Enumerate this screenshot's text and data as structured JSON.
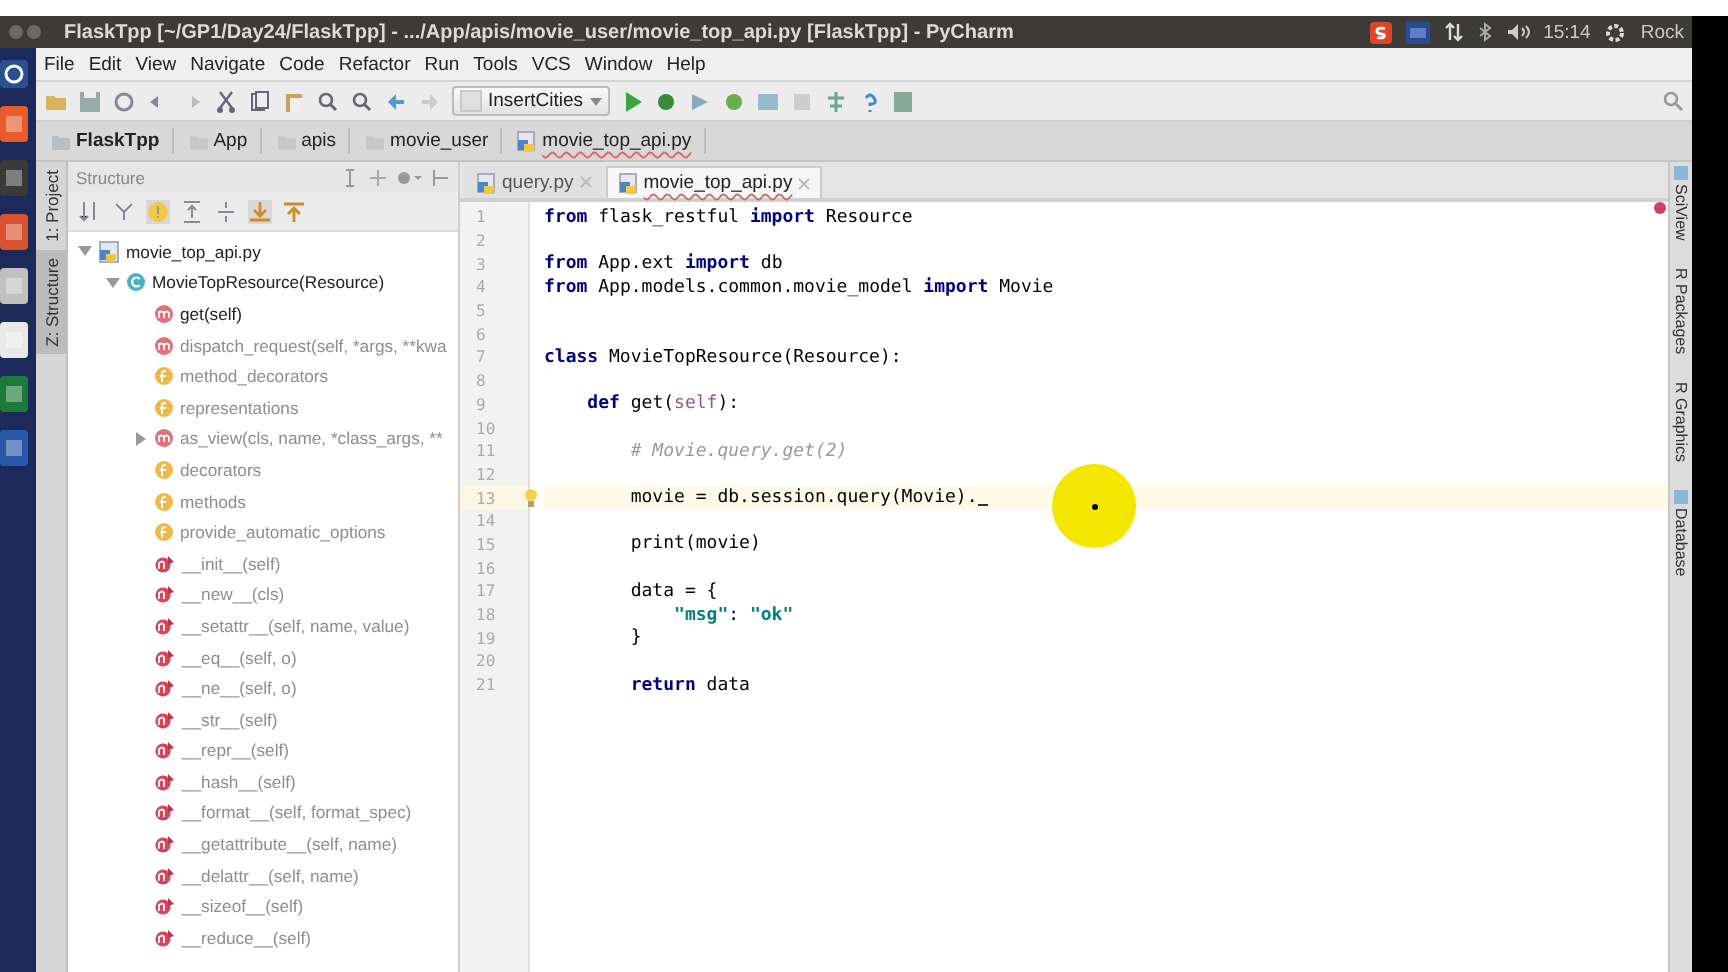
{
  "desktop": {
    "clock": "15:14",
    "user": "Rock"
  },
  "window": {
    "title": "FlaskTpp [~/GP1/Day24/FlaskTpp] - .../App/apis/movie_user/movie_top_api.py [FlaskTpp] - PyCharm"
  },
  "menu": [
    "File",
    "Edit",
    "View",
    "Navigate",
    "Code",
    "Refactor",
    "Run",
    "Tools",
    "VCS",
    "Window",
    "Help"
  ],
  "toolbar": {
    "run_config": "InsertCities"
  },
  "breadcrumbs": [
    {
      "label": "FlaskTpp",
      "kind": "project"
    },
    {
      "label": "App",
      "kind": "folder"
    },
    {
      "label": "apis",
      "kind": "folder"
    },
    {
      "label": "movie_user",
      "kind": "folder"
    },
    {
      "label": "movie_top_api.py",
      "kind": "file"
    }
  ],
  "left_tool_tabs": [
    {
      "label": "1: Project",
      "selected": false
    },
    {
      "label": "Z: Structure",
      "selected": true
    }
  ],
  "structure": {
    "title": "Structure",
    "tree": [
      {
        "label": "movie_top_api.py",
        "kind": "file",
        "expanded": true,
        "children": [
          {
            "label": "MovieTopResource(Resource)",
            "kind": "class",
            "expanded": true,
            "children": [
              {
                "label": "get(self)",
                "kind": "method",
                "inherited": false
              },
              {
                "label": "dispatch_request(self, *args, **kwa",
                "kind": "method",
                "inherited": true
              },
              {
                "label": "method_decorators",
                "kind": "field",
                "inherited": true
              },
              {
                "label": "representations",
                "kind": "field",
                "inherited": true
              },
              {
                "label": "as_view(cls, name, *class_args, **",
                "kind": "method",
                "inherited": true,
                "expanded": false
              },
              {
                "label": "decorators",
                "kind": "field",
                "inherited": true
              },
              {
                "label": "methods",
                "kind": "field",
                "inherited": true
              },
              {
                "label": "provide_automatic_options",
                "kind": "field",
                "inherited": true
              },
              {
                "label": "__init__(self)",
                "kind": "special",
                "inherited": true
              },
              {
                "label": "__new__(cls)",
                "kind": "special",
                "inherited": true
              },
              {
                "label": "__setattr__(self, name, value)",
                "kind": "special",
                "inherited": true
              },
              {
                "label": "__eq__(self, o)",
                "kind": "special",
                "inherited": true
              },
              {
                "label": "__ne__(self, o)",
                "kind": "special",
                "inherited": true
              },
              {
                "label": "__str__(self)",
                "kind": "special",
                "inherited": true
              },
              {
                "label": "__repr__(self)",
                "kind": "special",
                "inherited": true
              },
              {
                "label": "__hash__(self)",
                "kind": "special",
                "inherited": true
              },
              {
                "label": "__format__(self, format_spec)",
                "kind": "special",
                "inherited": true
              },
              {
                "label": "__getattribute__(self, name)",
                "kind": "special",
                "inherited": true
              },
              {
                "label": "__delattr__(self, name)",
                "kind": "special",
                "inherited": true
              },
              {
                "label": "__sizeof__(self)",
                "kind": "special",
                "inherited": true
              },
              {
                "label": "__reduce__(self)",
                "kind": "special",
                "inherited": true
              }
            ]
          }
        ]
      }
    ]
  },
  "editor": {
    "tabs": [
      {
        "label": "query.py",
        "selected": false
      },
      {
        "label": "movie_top_api.py",
        "selected": true
      }
    ],
    "lines": [
      {
        "number": "1",
        "current": false,
        "tokens": [
          {
            "text": "from",
            "kind": "kw"
          },
          {
            "text": " flask_restful ",
            "kind": "plain"
          },
          {
            "text": "import",
            "kind": "kw"
          },
          {
            "text": " Resource",
            "kind": "plain"
          }
        ]
      },
      {
        "number": "2",
        "current": false
      },
      {
        "number": "3",
        "current": false,
        "tokens": [
          {
            "text": "from",
            "kind": "kw"
          },
          {
            "text": " App.ext ",
            "kind": "plain"
          },
          {
            "text": "import",
            "kind": "kw"
          },
          {
            "text": " db",
            "kind": "plain"
          }
        ]
      },
      {
        "number": "4",
        "current": false,
        "tokens": [
          {
            "text": "from",
            "kind": "kw"
          },
          {
            "text": " App.models.common.movie_model ",
            "kind": "plain"
          },
          {
            "text": "import",
            "kind": "kw"
          },
          {
            "text": " Movie",
            "kind": "plain"
          }
        ]
      },
      {
        "number": "5",
        "current": false
      },
      {
        "number": "6",
        "current": false
      },
      {
        "number": "7",
        "current": false,
        "tokens": [
          {
            "text": "class",
            "kind": "kw"
          },
          {
            "text": " MovieTopResource(Resource):",
            "kind": "plain"
          }
        ]
      },
      {
        "number": "8",
        "current": false
      },
      {
        "number": "9",
        "current": false,
        "tokens": [
          {
            "text": "    def",
            "kind": "kw"
          },
          {
            "text": " get(",
            "kind": "plain"
          },
          {
            "text": "self",
            "kind": "self"
          },
          {
            "text": "):",
            "kind": "plain"
          }
        ]
      },
      {
        "number": "10",
        "current": false
      },
      {
        "number": "11",
        "current": false,
        "tokens": [
          {
            "text": "        # Movie.query.get(2)",
            "kind": "comment"
          }
        ]
      },
      {
        "number": "12",
        "current": false
      },
      {
        "number": "13",
        "current": true,
        "tokens": [
          {
            "text": "        movie = db.session.query(Movie).",
            "kind": "plain"
          }
        ]
      },
      {
        "number": "14",
        "current": false
      },
      {
        "number": "15",
        "current": false,
        "tokens": [
          {
            "text": "        print(movie)",
            "kind": "plain"
          }
        ]
      },
      {
        "number": "16",
        "current": false
      },
      {
        "number": "17",
        "current": false,
        "tokens": [
          {
            "text": "        data = {",
            "kind": "plain"
          }
        ]
      },
      {
        "number": "18",
        "current": false,
        "tokens": [
          {
            "text": "            \"msg\"",
            "kind": "str"
          },
          {
            "text": ": ",
            "kind": "plain"
          },
          {
            "text": "\"ok\"",
            "kind": "str"
          }
        ]
      },
      {
        "number": "19",
        "current": false,
        "tokens": [
          {
            "text": "        }",
            "kind": "plain"
          }
        ]
      },
      {
        "number": "20",
        "current": false
      },
      {
        "number": "21",
        "current": false,
        "tokens": [
          {
            "text": "        return",
            "kind": "kw"
          },
          {
            "text": " data",
            "kind": "plain"
          }
        ]
      }
    ]
  },
  "right_tool_tabs": [
    {
      "label": "SciView"
    },
    {
      "label": "R Packages"
    },
    {
      "label": "R Graphics"
    },
    {
      "label": "Database"
    }
  ]
}
